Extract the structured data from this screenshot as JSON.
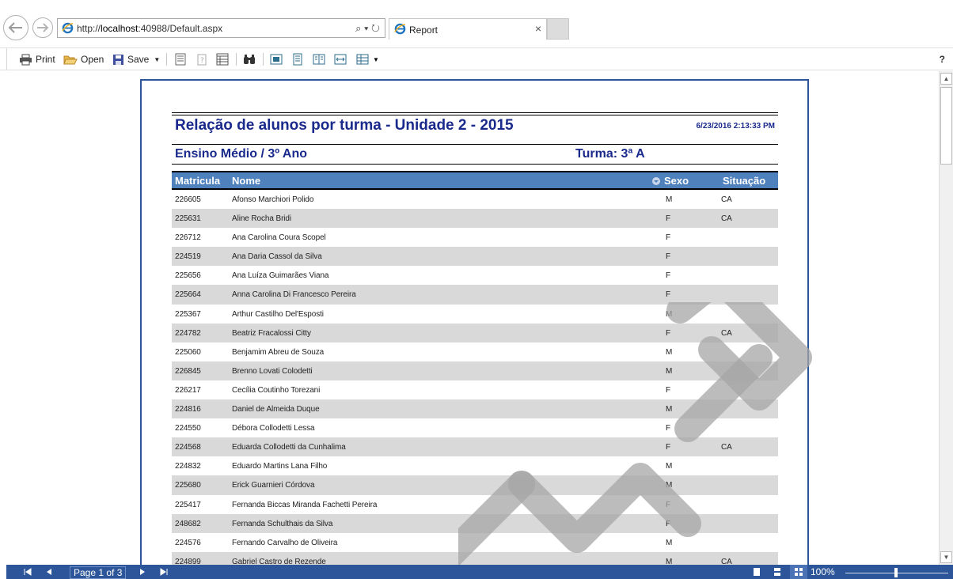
{
  "browser": {
    "url_prefix": "http://",
    "url_host": "localhost",
    "url_rest": ":40988/Default.aspx",
    "tab_title": "Report",
    "tab_close": "×",
    "address_tools": "⌕ ▾ ↻"
  },
  "toolbar": {
    "print_label": "Print",
    "open_label": "Open",
    "save_label": "Save",
    "help_label": "?"
  },
  "report": {
    "title": "Relação de alunos por turma - Unidade 2 - 2015",
    "date": "6/23/2016 2:13:33 PM",
    "level": "Ensino Médio / 3º Ano",
    "class_label": "Turma: 3ª A",
    "columns": {
      "matricula": "Matricula",
      "nome": "Nome",
      "sexo": "Sexo",
      "situacao": "Situação"
    },
    "rows": [
      {
        "matricula": "226605",
        "nome": "Afonso Marchiori Polido",
        "sexo": "M",
        "situacao": "CA"
      },
      {
        "matricula": "225631",
        "nome": "Aline Rocha Bridi",
        "sexo": "F",
        "situacao": "CA"
      },
      {
        "matricula": "226712",
        "nome": "Ana Carolina Coura Scopel",
        "sexo": "F",
        "situacao": ""
      },
      {
        "matricula": "224519",
        "nome": "Ana Daria Cassol da Silva",
        "sexo": "F",
        "situacao": ""
      },
      {
        "matricula": "225656",
        "nome": "Ana Luíza Guimarães Viana",
        "sexo": "F",
        "situacao": ""
      },
      {
        "matricula": "225664",
        "nome": "Anna Carolina Di Francesco Pereira",
        "sexo": "F",
        "situacao": ""
      },
      {
        "matricula": "225367",
        "nome": "Arthur Castilho Del'Esposti",
        "sexo": "M",
        "situacao": ""
      },
      {
        "matricula": "224782",
        "nome": "Beatriz Fracalossi Citty",
        "sexo": "F",
        "situacao": "CA"
      },
      {
        "matricula": "225060",
        "nome": "Benjamim Abreu de Souza",
        "sexo": "M",
        "situacao": ""
      },
      {
        "matricula": "226845",
        "nome": "Brenno Lovati Colodetti",
        "sexo": "M",
        "situacao": ""
      },
      {
        "matricula": "226217",
        "nome": "Cecília Coutinho Torezani",
        "sexo": "F",
        "situacao": ""
      },
      {
        "matricula": "224816",
        "nome": "Daniel de Almeida Duque",
        "sexo": "M",
        "situacao": ""
      },
      {
        "matricula": "224550",
        "nome": "Débora Collodetti Lessa",
        "sexo": "F",
        "situacao": ""
      },
      {
        "matricula": "224568",
        "nome": "Eduarda Collodetti da Cunhalima",
        "sexo": "F",
        "situacao": "CA"
      },
      {
        "matricula": "224832",
        "nome": "Eduardo Martins Lana Filho",
        "sexo": "M",
        "situacao": ""
      },
      {
        "matricula": "225680",
        "nome": "Erick Guarnieri Córdova",
        "sexo": "M",
        "situacao": ""
      },
      {
        "matricula": "225417",
        "nome": "Fernanda Biccas Miranda Fachetti Pereira",
        "sexo": "F",
        "situacao": ""
      },
      {
        "matricula": "248682",
        "nome": "Fernanda Schulthais da Silva",
        "sexo": "F",
        "situacao": ""
      },
      {
        "matricula": "224576",
        "nome": "Fernando Carvalho de Oliveira",
        "sexo": "M",
        "situacao": ""
      },
      {
        "matricula": "224899",
        "nome": "Gabriel Castro de Rezende",
        "sexo": "M",
        "situacao": "CA"
      }
    ]
  },
  "status": {
    "page_indicator": "Page 1 of 3",
    "zoom": "100%"
  },
  "colors": {
    "accent": "#2c5699",
    "header_fill": "#4f81bd",
    "title_text": "#1a2a8c",
    "alt_row": "#d9d9d9"
  }
}
